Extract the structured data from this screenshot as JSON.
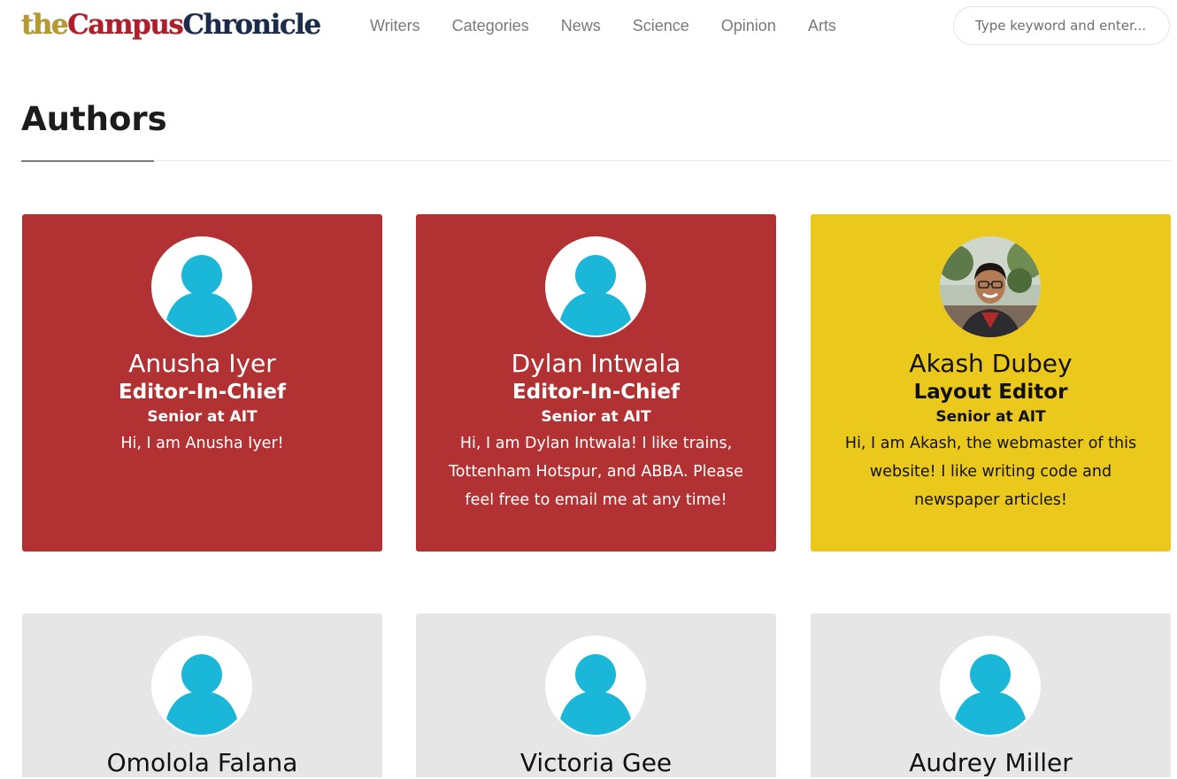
{
  "logo": {
    "part1": "the",
    "part2": "Campus",
    "part3": "Chronicle"
  },
  "nav": [
    "Writers",
    "Categories",
    "News",
    "Science",
    "Opinion",
    "Arts"
  ],
  "search": {
    "placeholder": "Type keyword and enter..."
  },
  "page_title": "Authors",
  "colors": {
    "card_red": "#b23234",
    "card_yellow": "#ebc91c",
    "card_gray": "#e6e6e6",
    "avatar_icon": "#1bb7d8"
  },
  "authors": [
    {
      "name": "Anusha Iyer",
      "role": "Editor-In-Chief",
      "school": "Senior at AIT",
      "bio": "Hi, I am Anusha Iyer!",
      "avatar": "default-user-icon"
    },
    {
      "name": "Dylan Intwala",
      "role": "Editor-In-Chief",
      "school": "Senior at AIT",
      "bio": "Hi, I am Dylan Intwala! I like trains, Tottenham Hotspur, and ABBA. Please feel free to email me at any time!",
      "avatar": "default-user-icon"
    },
    {
      "name": "Akash Dubey",
      "role": "Layout Editor",
      "school": "Senior at AIT",
      "bio": "Hi, I am Akash, the webmaster of this website! I like writing code and newspaper articles!",
      "avatar": "profile-photo"
    },
    {
      "name": "Omolola Falana",
      "avatar": "default-user-icon"
    },
    {
      "name": "Victoria Gee",
      "avatar": "default-user-icon"
    },
    {
      "name": "Audrey Miller",
      "avatar": "default-user-icon"
    }
  ]
}
